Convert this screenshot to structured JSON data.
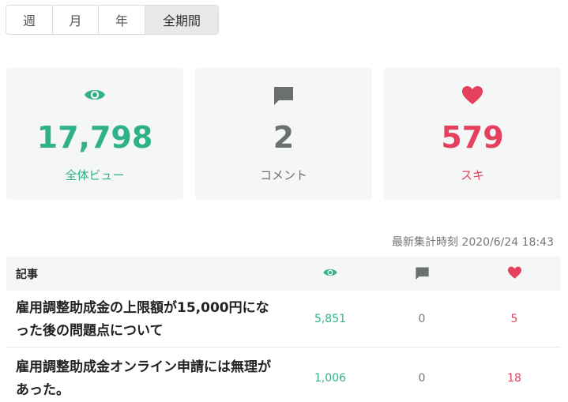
{
  "tabs": [
    {
      "label": "週"
    },
    {
      "label": "月"
    },
    {
      "label": "年"
    },
    {
      "label": "全期間"
    }
  ],
  "stats": {
    "views": {
      "value": "17,798",
      "label": "全体ビュー",
      "icon": "eye-icon"
    },
    "comments": {
      "value": "2",
      "label": "コメント",
      "icon": "comment-icon"
    },
    "likes": {
      "value": "579",
      "label": "スキ",
      "icon": "heart-icon"
    }
  },
  "updated": "最新集計時刻 2020/6/24 18:43",
  "table": {
    "header": {
      "title": "記事"
    },
    "rows": [
      {
        "title": "雇用調整助成金の上限額が15,000円になった後の問題点について",
        "views": "5,851",
        "comments": "0",
        "likes": "5"
      },
      {
        "title": "雇用調整助成金オンライン申請には無理があった。",
        "views": "1,006",
        "comments": "0",
        "likes": "18"
      }
    ]
  },
  "colors": {
    "green": "#2fb189",
    "grey": "#6b6f6f",
    "red": "#e5415e",
    "card_bg": "#f5f7f6"
  }
}
